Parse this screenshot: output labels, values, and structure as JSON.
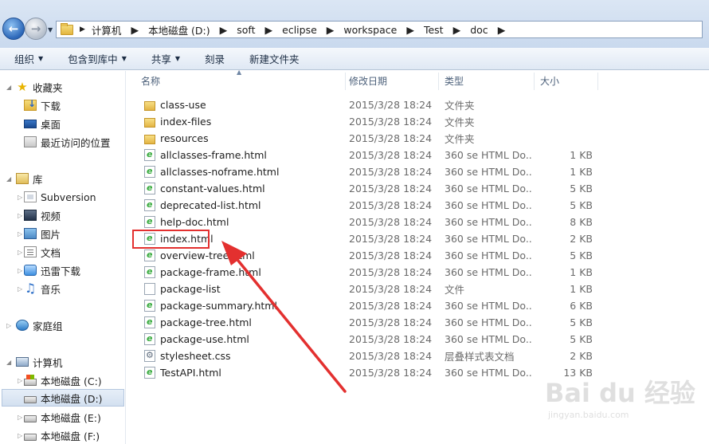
{
  "address": {
    "crumbs": [
      "计算机",
      "本地磁盘 (D:)",
      "soft",
      "eclipse",
      "workspace",
      "Test",
      "doc"
    ]
  },
  "toolbar": {
    "organize": "组织",
    "include_library": "包含到库中",
    "share": "共享",
    "burn": "刻录",
    "new_folder": "新建文件夹"
  },
  "nav": {
    "favorites": "收藏夹",
    "downloads": "下载",
    "desktop": "桌面",
    "recent": "最近访问的位置",
    "libraries": "库",
    "subversion": "Subversion",
    "videos": "视频",
    "pictures": "图片",
    "documents": "文档",
    "xunlei": "迅雷下载",
    "music": "音乐",
    "homegroup": "家庭组",
    "computer": "计算机",
    "drive_c": "本地磁盘 (C:)",
    "drive_d": "本地磁盘 (D:)",
    "drive_e": "本地磁盘 (E:)",
    "drive_f": "本地磁盘 (F:)"
  },
  "columns": {
    "name": "名称",
    "modified": "修改日期",
    "type": "类型",
    "size": "大小"
  },
  "files": [
    {
      "name": "class-use",
      "date": "2015/3/28 18:24",
      "type": "文件夹",
      "size": "",
      "icon": "folder-icon"
    },
    {
      "name": "index-files",
      "date": "2015/3/28 18:24",
      "type": "文件夹",
      "size": "",
      "icon": "folder-icon"
    },
    {
      "name": "resources",
      "date": "2015/3/28 18:24",
      "type": "文件夹",
      "size": "",
      "icon": "folder-icon"
    },
    {
      "name": "allclasses-frame.html",
      "date": "2015/3/28 18:24",
      "type": "360 se HTML Do...",
      "size": "1 KB",
      "icon": "html-file-icon"
    },
    {
      "name": "allclasses-noframe.html",
      "date": "2015/3/28 18:24",
      "type": "360 se HTML Do...",
      "size": "1 KB",
      "icon": "html-file-icon"
    },
    {
      "name": "constant-values.html",
      "date": "2015/3/28 18:24",
      "type": "360 se HTML Do...",
      "size": "5 KB",
      "icon": "html-file-icon"
    },
    {
      "name": "deprecated-list.html",
      "date": "2015/3/28 18:24",
      "type": "360 se HTML Do...",
      "size": "5 KB",
      "icon": "html-file-icon"
    },
    {
      "name": "help-doc.html",
      "date": "2015/3/28 18:24",
      "type": "360 se HTML Do...",
      "size": "8 KB",
      "icon": "html-file-icon"
    },
    {
      "name": "index.html",
      "date": "2015/3/28 18:24",
      "type": "360 se HTML Do...",
      "size": "2 KB",
      "icon": "html-file-icon"
    },
    {
      "name": "overview-tree.html",
      "date": "2015/3/28 18:24",
      "type": "360 se HTML Do...",
      "size": "5 KB",
      "icon": "html-file-icon"
    },
    {
      "name": "package-frame.html",
      "date": "2015/3/28 18:24",
      "type": "360 se HTML Do...",
      "size": "1 KB",
      "icon": "html-file-icon"
    },
    {
      "name": "package-list",
      "date": "2015/3/28 18:24",
      "type": "文件",
      "size": "1 KB",
      "icon": "file-icon"
    },
    {
      "name": "package-summary.html",
      "date": "2015/3/28 18:24",
      "type": "360 se HTML Do...",
      "size": "6 KB",
      "icon": "html-file-icon"
    },
    {
      "name": "package-tree.html",
      "date": "2015/3/28 18:24",
      "type": "360 se HTML Do...",
      "size": "5 KB",
      "icon": "html-file-icon"
    },
    {
      "name": "package-use.html",
      "date": "2015/3/28 18:24",
      "type": "360 se HTML Do...",
      "size": "5 KB",
      "icon": "html-file-icon"
    },
    {
      "name": "stylesheet.css",
      "date": "2015/3/28 18:24",
      "type": "层叠样式表文档",
      "size": "2 KB",
      "icon": "css-file-icon"
    },
    {
      "name": "TestAPI.html",
      "date": "2015/3/28 18:24",
      "type": "360 se HTML Do...",
      "size": "13 KB",
      "icon": "html-file-icon"
    }
  ],
  "annotation": {
    "highlight_color": "#e3302f"
  },
  "watermark": {
    "brand": "Bai du 经验",
    "url": "jingyan.baidu.com"
  }
}
